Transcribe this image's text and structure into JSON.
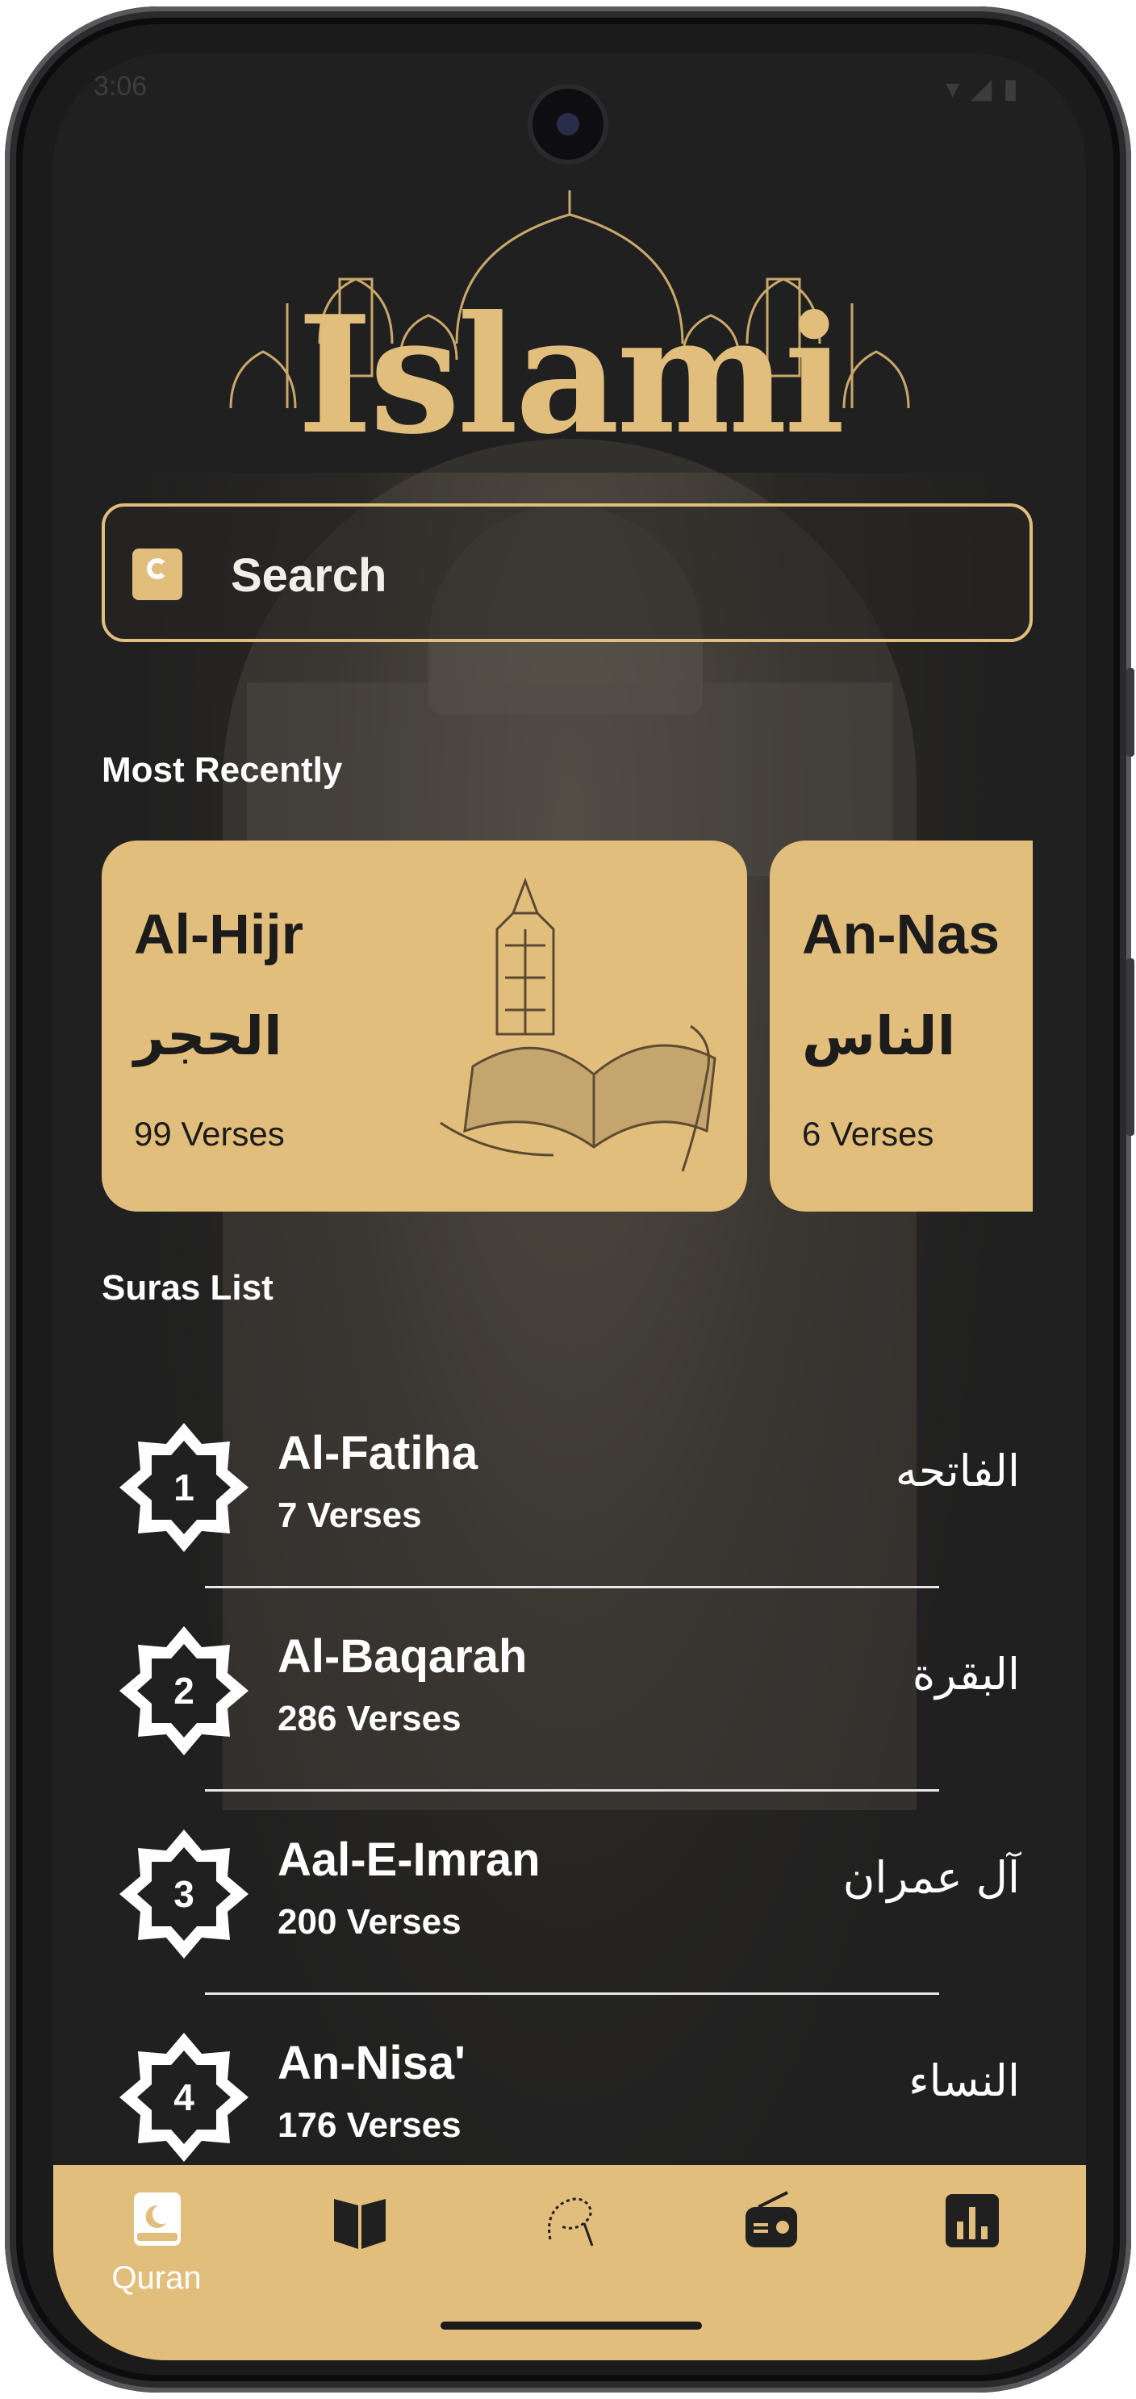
{
  "status_bar": {
    "time": "3:06"
  },
  "app": {
    "logo": "Islami"
  },
  "search": {
    "placeholder": "Search"
  },
  "most_recently": {
    "title": "Most Recently",
    "cards": [
      {
        "name_en": "Al-Hijr",
        "name_ar": "الحجر",
        "verses": "99 Verses"
      },
      {
        "name_en": "An-Nas",
        "name_ar": "الناس",
        "verses": "6 Verses"
      }
    ]
  },
  "suras_list": {
    "title": "Suras List",
    "items": [
      {
        "number": "1",
        "name_en": "Al-Fatiha",
        "verses": "7 Verses",
        "name_ar": "الفاتحه"
      },
      {
        "number": "2",
        "name_en": "Al-Baqarah",
        "verses": "286 Verses",
        "name_ar": "البقرة"
      },
      {
        "number": "3",
        "name_en": "Aal-E-Imran",
        "verses": "200 Verses",
        "name_ar": "آل عمران"
      },
      {
        "number": "4",
        "name_en": "An-Nisa'",
        "verses": "176 Verses",
        "name_ar": "النساء"
      }
    ]
  },
  "bottom_nav": {
    "items": [
      {
        "label": "Quran",
        "icon": "quran-icon",
        "active": true
      },
      {
        "label": "",
        "icon": "book-icon",
        "active": false
      },
      {
        "label": "",
        "icon": "sebha-icon",
        "active": false
      },
      {
        "label": "",
        "icon": "radio-icon",
        "active": false
      },
      {
        "label": "",
        "icon": "time-chart-icon",
        "active": false
      }
    ]
  },
  "colors": {
    "accent": "#e2be7c",
    "background": "#202020",
    "text": "#ffffff"
  }
}
